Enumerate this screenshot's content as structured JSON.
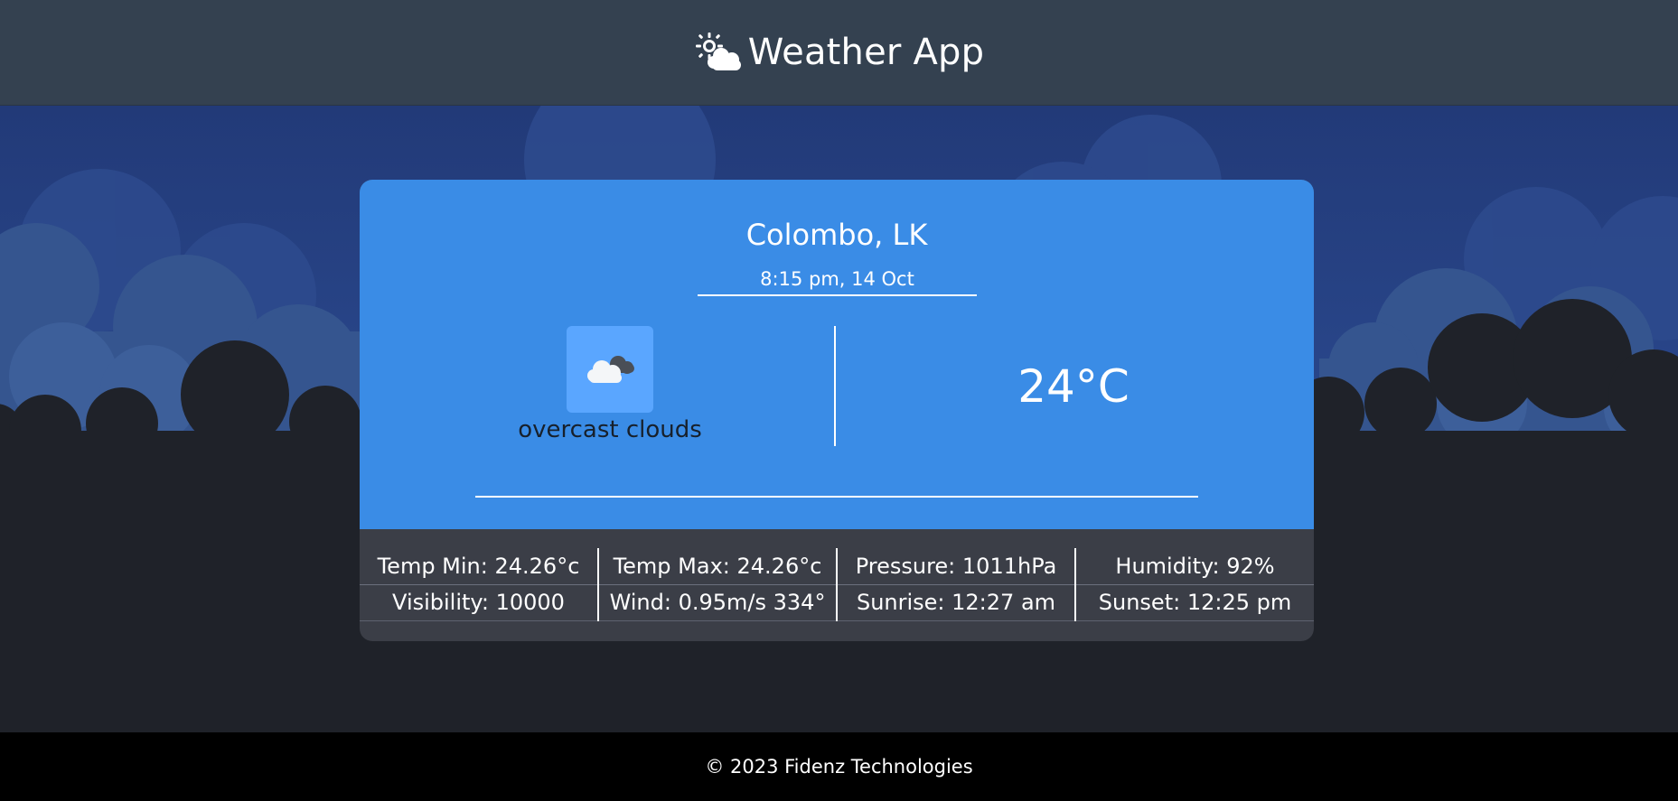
{
  "header": {
    "title": "Weather App",
    "icon": "sun-cloud-icon"
  },
  "weather": {
    "location": "Colombo, LK",
    "datetime": "8:15 pm, 14 Oct",
    "condition": "overcast clouds",
    "condition_icon": "overcast-cloud-icon",
    "temperature": "24°C"
  },
  "stats": {
    "temp_min": "Temp Min: 24.26°c",
    "temp_max": "Temp Max: 24.26°c",
    "pressure": "Pressure: 1011hPa",
    "humidity": "Humidity: 92%",
    "visibility": "Visibility: 10000",
    "wind": "Wind: 0.95m/s 334°",
    "sunrise": "Sunrise: 12:27 am",
    "sunset": "Sunset: 12:25 pm"
  },
  "footer": {
    "copyright": "© 2023 Fidenz Technologies"
  },
  "colors": {
    "header_bg": "#344150",
    "sky_top": "#233d7a",
    "card_blue": "#3a8ce6",
    "stats_bg": "#3b3e47",
    "footer_bg": "#000000",
    "dark_ground": "#1f2229"
  }
}
